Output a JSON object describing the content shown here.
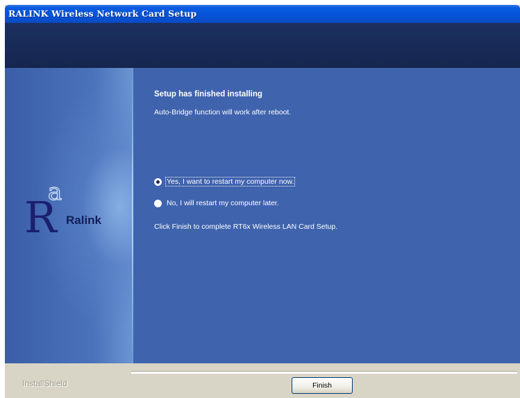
{
  "window": {
    "title": "RALINK Wireless Network Card Setup"
  },
  "logo": {
    "brand_text": "Ralink"
  },
  "main": {
    "heading": "Setup has finished installing",
    "subtext": "Auto-Bridge function will work after reboot.",
    "options": [
      {
        "label": "Yes, I want to restart my computer now.",
        "selected": true
      },
      {
        "label": "No, I will restart my computer later.",
        "selected": false
      }
    ],
    "note": "Click Finish to complete RT6x Wireless LAN Card Setup."
  },
  "footer": {
    "brand": "InstallShield",
    "finish_label": "Finish"
  },
  "colors": {
    "titlebar": "#0553d6",
    "header_band": "#172a55",
    "content_bg": "#3f63ad",
    "footer_bg": "#d9d5c6",
    "logo_text": "#121e5a"
  }
}
